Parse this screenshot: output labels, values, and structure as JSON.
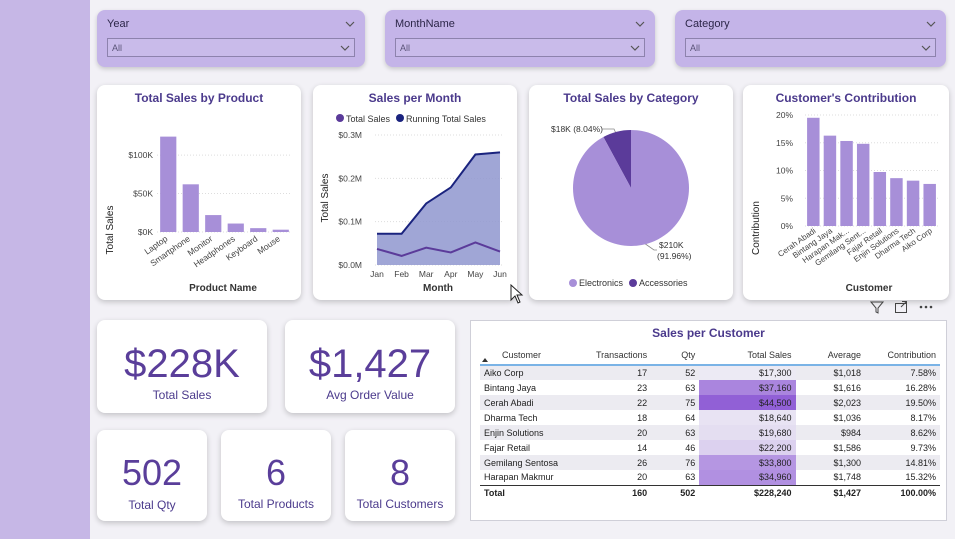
{
  "slicers": [
    {
      "title": "Year",
      "value": "All"
    },
    {
      "title": "MonthName",
      "value": "All"
    },
    {
      "title": "Category",
      "value": "All"
    }
  ],
  "charts": {
    "product": {
      "title": "Total Sales by Product",
      "ylabel": "Total Sales",
      "xlabel": "Product Name",
      "ticks": [
        "$0K",
        "$50K",
        "$100K"
      ]
    },
    "month": {
      "title": "Sales per Month",
      "legend": [
        "Total Sales",
        "Running Total Sales"
      ],
      "ylabel": "Total Sales",
      "xlabel": "Month",
      "ticks": [
        "$0.0M",
        "$0.1M",
        "$0.2M",
        "$0.3M"
      ]
    },
    "category": {
      "title": "Total Sales by Category",
      "label_small": "$18K (8.04%)",
      "label_big_1": "$210K",
      "label_big_2": "(91.96%)",
      "legend": [
        "Electronics",
        "Accessories"
      ]
    },
    "contribution": {
      "title": "Customer's Contribution",
      "ylabel": "Contribution",
      "xlabel": "Customer",
      "ticks": [
        "0%",
        "5%",
        "10%",
        "15%",
        "20%"
      ]
    }
  },
  "chart_data": [
    {
      "type": "bar",
      "title": "Total Sales by Product",
      "xlabel": "Product Name",
      "ylabel": "Total Sales",
      "categories": [
        "Laptop",
        "Smartphone",
        "Monitor",
        "Headphones",
        "Keyboard",
        "Mouse"
      ],
      "values": [
        124000,
        62000,
        22000,
        11000,
        5000,
        3000
      ],
      "ylim": [
        0,
        130000
      ]
    },
    {
      "type": "area",
      "title": "Sales per Month",
      "xlabel": "Month",
      "ylabel": "Total Sales",
      "categories": [
        "Jan",
        "Feb",
        "Mar",
        "Apr",
        "May",
        "Jun"
      ],
      "series": [
        {
          "name": "Total Sales",
          "values": [
            37000,
            21000,
            40000,
            29000,
            52000,
            31000
          ]
        },
        {
          "name": "Running Total Sales",
          "values": [
            72000,
            72000,
            142000,
            179000,
            255000,
            260000
          ]
        }
      ],
      "ylim": [
        0,
        300000
      ]
    },
    {
      "type": "pie",
      "title": "Total Sales by Category",
      "categories": [
        "Electronics",
        "Accessories"
      ],
      "values": [
        210000,
        18000
      ],
      "percent": [
        91.96,
        8.04
      ]
    },
    {
      "type": "bar",
      "title": "Customer's Contribution",
      "xlabel": "Customer",
      "ylabel": "Contribution",
      "categories": [
        "Cerah Abadi",
        "Bintang Jaya",
        "Harapan Mak...",
        "Gemilang Sent...",
        "Fajar Retail",
        "Enjin Solutions",
        "Dharma Tech",
        "Aiko Corp"
      ],
      "values": [
        19.5,
        16.28,
        15.32,
        14.81,
        9.73,
        8.62,
        8.17,
        7.58
      ],
      "ylim": [
        0,
        20
      ]
    }
  ],
  "kpis": {
    "total_sales": {
      "value": "$228K",
      "label": "Total Sales"
    },
    "avg_order": {
      "value": "$1,427",
      "label": "Avg Order Value"
    },
    "total_qty": {
      "value": "502",
      "label": "Total Qty"
    },
    "total_products": {
      "value": "6",
      "label": "Total Products"
    },
    "total_customers": {
      "value": "8",
      "label": "Total Customers"
    }
  },
  "table": {
    "title": "Sales per Customer",
    "headers": [
      "Customer",
      "Transactions",
      "Qty",
      "Total Sales",
      "Average",
      "Contribution"
    ],
    "rows": [
      [
        "Aiko Corp",
        "17",
        "52",
        "$17,300",
        "$1,018",
        "7.58%"
      ],
      [
        "Bintang Jaya",
        "23",
        "63",
        "$37,160",
        "$1,616",
        "16.28%"
      ],
      [
        "Cerah Abadi",
        "22",
        "75",
        "$44,500",
        "$2,023",
        "19.50%"
      ],
      [
        "Dharma Tech",
        "18",
        "64",
        "$18,640",
        "$1,036",
        "8.17%"
      ],
      [
        "Enjin Solutions",
        "20",
        "63",
        "$19,680",
        "$984",
        "8.62%"
      ],
      [
        "Fajar Retail",
        "14",
        "46",
        "$22,200",
        "$1,586",
        "9.73%"
      ],
      [
        "Gemilang Sentosa",
        "26",
        "76",
        "$33,800",
        "$1,300",
        "14.81%"
      ],
      [
        "Harapan Makmur",
        "20",
        "63",
        "$34,960",
        "$1,748",
        "15.32%"
      ]
    ],
    "total": [
      "Total",
      "160",
      "502",
      "$228,240",
      "$1,427",
      "100.00%"
    ]
  },
  "colors": {
    "accent": "#a78fd8",
    "dark": "#5b3b9a",
    "navy": "#1a237e",
    "area": "#8f96cf"
  }
}
